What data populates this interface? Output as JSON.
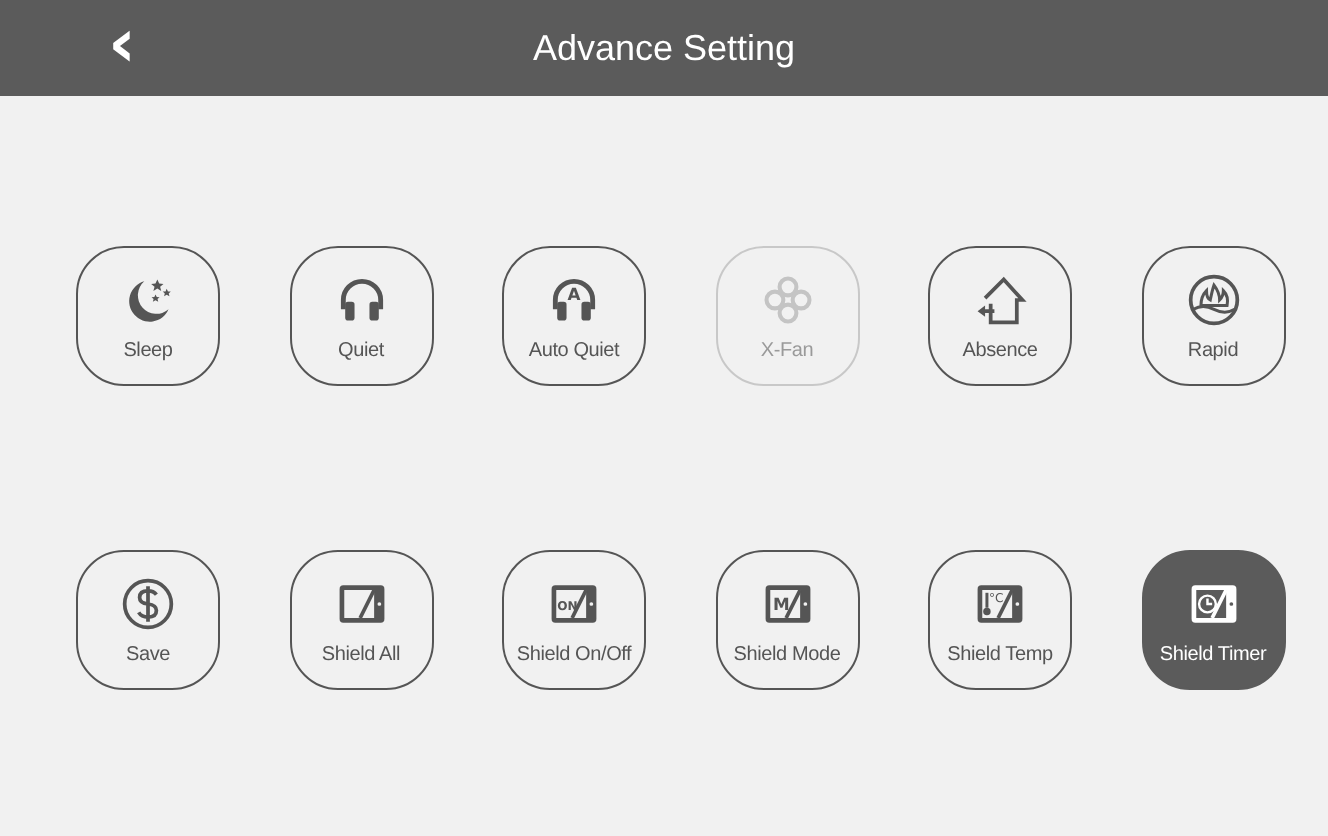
{
  "header": {
    "back": "‹",
    "title": "Advance Setting"
  },
  "buttons": [
    {
      "label": "Sleep",
      "kind": "moon",
      "disabled": false,
      "selected": false
    },
    {
      "label": "Quiet",
      "kind": "headphones",
      "disabled": false,
      "selected": false
    },
    {
      "label": "Auto Quiet",
      "kind": "headphones",
      "badge": "A",
      "disabled": false,
      "selected": false
    },
    {
      "label": "X-Fan",
      "kind": "fan",
      "disabled": true,
      "selected": false
    },
    {
      "label": "Absence",
      "kind": "house",
      "disabled": false,
      "selected": false
    },
    {
      "label": "Rapid",
      "kind": "flame",
      "disabled": false,
      "selected": false
    },
    {
      "label": "Save",
      "kind": "dollar",
      "disabled": false,
      "selected": false
    },
    {
      "label": "Shield All",
      "kind": "shield",
      "disabled": false,
      "selected": false
    },
    {
      "label": "Shield On/Off",
      "kind": "shield",
      "badge": "ON",
      "disabled": false,
      "selected": false
    },
    {
      "label": "Shield Mode",
      "kind": "shield",
      "badge": "M",
      "disabled": false,
      "selected": false
    },
    {
      "label": "Shield Temp",
      "kind": "shield-temp",
      "badge": "°C",
      "disabled": false,
      "selected": false
    },
    {
      "label": "Shield Timer",
      "kind": "shield-clock",
      "disabled": false,
      "selected": true
    }
  ]
}
